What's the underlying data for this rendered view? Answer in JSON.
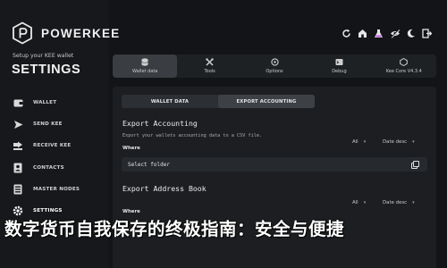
{
  "app": {
    "brand": "POWERKEE",
    "subtitle": "Setup your KEE wallet",
    "section_title": "SETTINGS",
    "accent_color": "#ffffff",
    "background_color": "#121417"
  },
  "sidebar": {
    "items": [
      {
        "label": "WALLET",
        "icon": "wallet-icon",
        "active": false
      },
      {
        "label": "SEND KEE",
        "icon": "send-icon",
        "active": false
      },
      {
        "label": "RECEIVE KEE",
        "icon": "receive-icon",
        "active": false
      },
      {
        "label": "CONTACTS",
        "icon": "contacts-icon",
        "active": false
      },
      {
        "label": "MASTER NODES",
        "icon": "master-nodes-icon",
        "active": false
      },
      {
        "label": "SETTINGS",
        "icon": "settings-icon",
        "active": true
      }
    ]
  },
  "toolbar_icons": [
    "sync-icon",
    "home-icon",
    "flask-icon",
    "eye-off-icon",
    "moon-icon",
    "exit-icon"
  ],
  "tabs": [
    {
      "label": "Wallet data",
      "icon": "database-icon",
      "active": true
    },
    {
      "label": "Tools",
      "icon": "tools-icon",
      "active": false
    },
    {
      "label": "Options",
      "icon": "options-icon",
      "active": false
    },
    {
      "label": "Debug",
      "icon": "debug-icon",
      "active": false
    },
    {
      "label": "Kee Core V4.3.4",
      "icon": "core-icon",
      "active": false
    }
  ],
  "subtabs": [
    {
      "label": "WALLET DATA",
      "active": false
    },
    {
      "label": "EXPORT ACCOUNTING",
      "active": true
    }
  ],
  "export_accounting": {
    "title": "Export Accounting",
    "description": "Export your wallets accounting data to a CSV file.",
    "where_label": "Where",
    "filter_all": "All",
    "sort": "Date desc",
    "field_value": "Select folder"
  },
  "export_address_book": {
    "title": "Export Address Book",
    "where_label": "Where",
    "filter_all": "All",
    "sort": "Date desc"
  },
  "overlay_headline": "数字货币自我保存的终极指南：安全与便捷"
}
